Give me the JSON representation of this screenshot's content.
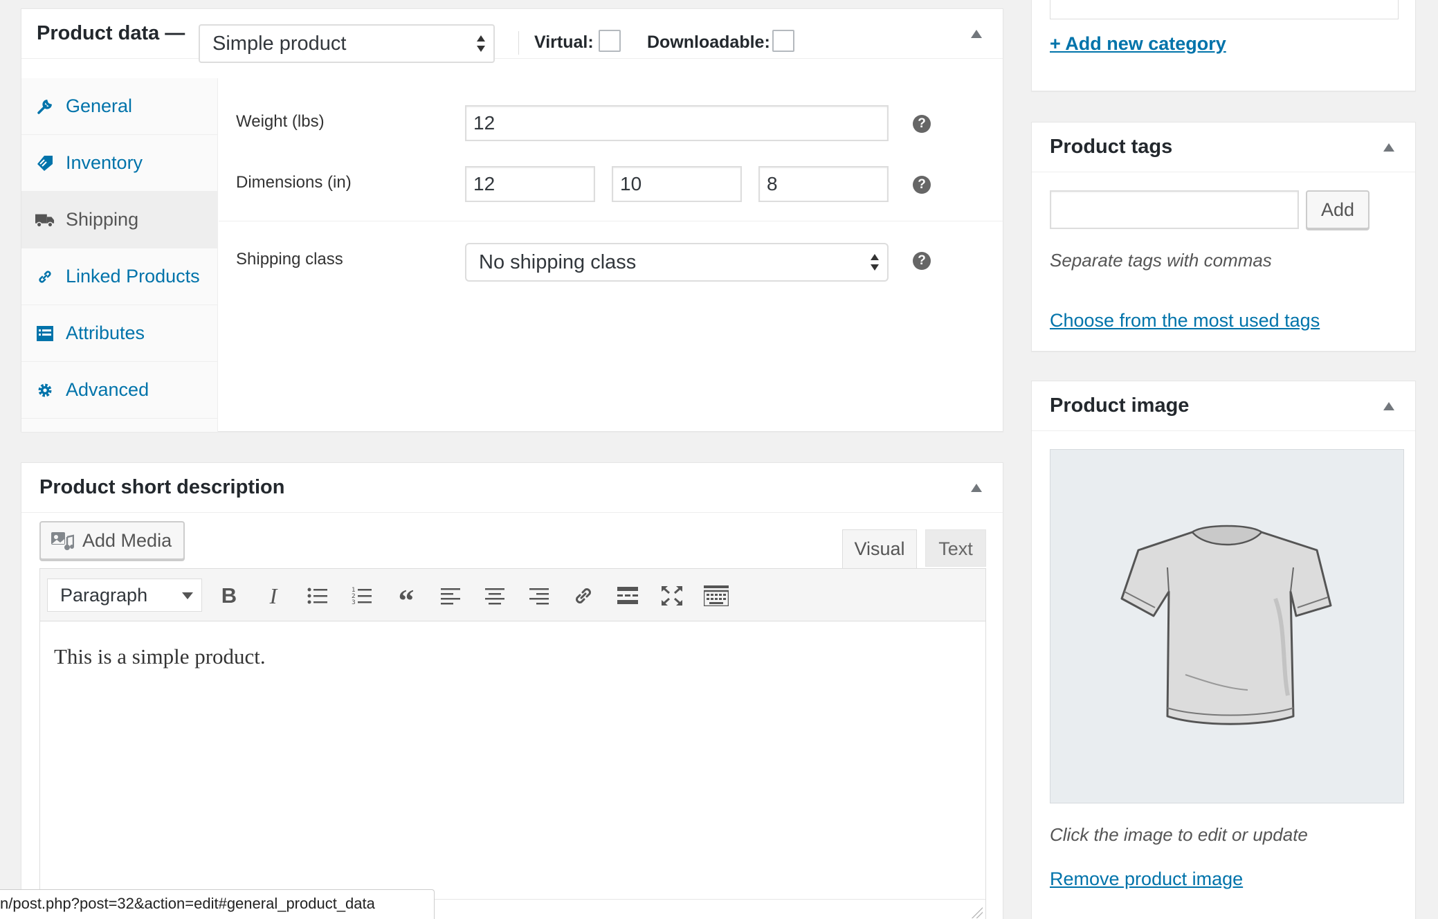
{
  "product_data": {
    "title": "Product data —",
    "product_type": "Simple product",
    "virtual_label": "Virtual:",
    "downloadable_label": "Downloadable:",
    "tabs": [
      {
        "label": "General",
        "icon": "wrench-icon"
      },
      {
        "label": "Inventory",
        "icon": "tag-icon"
      },
      {
        "label": "Shipping",
        "icon": "truck-icon",
        "active": true
      },
      {
        "label": "Linked Products",
        "icon": "link-icon"
      },
      {
        "label": "Attributes",
        "icon": "list-icon"
      },
      {
        "label": "Advanced",
        "icon": "gear-icon"
      }
    ],
    "shipping": {
      "weight_label": "Weight (lbs)",
      "weight_value": "12",
      "dimensions_label": "Dimensions (in)",
      "length": "12",
      "width": "10",
      "height": "8",
      "class_label": "Shipping class",
      "class_value": "No shipping class"
    }
  },
  "short_description": {
    "title": "Product short description",
    "add_media_label": "Add Media",
    "tab_visual": "Visual",
    "tab_text": "Text",
    "format_value": "Paragraph",
    "content": "This is a simple product.",
    "toolbar_icons": [
      "bold-icon",
      "italic-icon",
      "bullet-list-icon",
      "numbered-list-icon",
      "blockquote-icon",
      "align-left-icon",
      "align-center-icon",
      "align-right-icon",
      "link-icon",
      "read-more-icon",
      "fullscreen-icon",
      "toolbar-toggle-icon"
    ]
  },
  "category_box": {
    "add_category_link": "+ Add new category"
  },
  "tags_box": {
    "title": "Product tags",
    "add_button": "Add",
    "hint": "Separate tags with commas",
    "choose_link": "Choose from the most used tags"
  },
  "image_box": {
    "title": "Product image",
    "hint": "Click the image to edit or update",
    "remove_link": "Remove product image",
    "image_subject": "t-shirt"
  },
  "status_bar": {
    "url": "n/post.php?post=32&action=edit#general_product_data"
  },
  "colors": {
    "link": "#0073aa",
    "background": "#f1f1f1",
    "text": "#23282d"
  }
}
